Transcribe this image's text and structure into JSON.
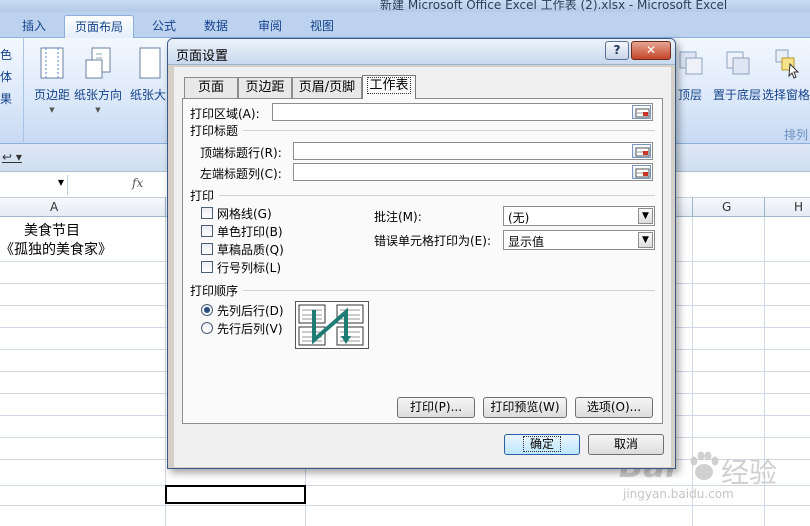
{
  "window": {
    "title": "新建 Microsoft Office Excel 工作表 (2).xlsx - Microsoft Excel"
  },
  "ribbon": {
    "tabs": [
      "插入",
      "页面布局",
      "公式",
      "数据",
      "审阅",
      "视图"
    ],
    "active_tab": "页面布局",
    "left_group_chars": [
      "色",
      "体",
      "果"
    ],
    "buttons": {
      "margins": "页边距",
      "orientation": "纸张方向",
      "size": "纸张大",
      "bring_forward": "顶层",
      "send_backward": "置于底层",
      "selection_pane": "选择窗格"
    },
    "arrange_group_label": "排列"
  },
  "formula_bar": {
    "fx": "fx"
  },
  "sheet": {
    "columns": [
      "A",
      "G",
      "H"
    ],
    "cells": {
      "a1": "美食节目",
      "a2": "《孤独的美食家》"
    }
  },
  "dialog": {
    "title": "页面设置",
    "help_glyph": "?",
    "close_glyph": "✕",
    "tabs": [
      "页面",
      "页边距",
      "页眉/页脚",
      "工作表"
    ],
    "active_tab": "工作表",
    "print_area": {
      "label": "打印区域(A):",
      "value": ""
    },
    "print_titles": {
      "section": "打印标题",
      "rows_label": "顶端标题行(R):",
      "rows_value": "",
      "cols_label": "左端标题列(C):",
      "cols_value": ""
    },
    "print": {
      "section": "打印",
      "options": [
        {
          "label": "网格线(G)",
          "checked": false
        },
        {
          "label": "单色打印(B)",
          "checked": false
        },
        {
          "label": "草稿品质(Q)",
          "checked": false
        },
        {
          "label": "行号列标(L)",
          "checked": false
        }
      ],
      "comments_label": "批注(M):",
      "comments_value": "(无)",
      "errors_label": "错误单元格打印为(E):",
      "errors_value": "显示值"
    },
    "page_order": {
      "section": "打印顺序",
      "options": [
        {
          "label": "先列后行(D)",
          "selected": true
        },
        {
          "label": "先行后列(V)",
          "selected": false
        }
      ]
    },
    "buttons": {
      "print": "打印(P)...",
      "preview": "打印预览(W)",
      "options": "选项(O)...",
      "ok": "确定",
      "cancel": "取消"
    }
  },
  "watermark": {
    "brand": "Bai",
    "cn": "经验",
    "url": "jingyan.baidu.com"
  }
}
